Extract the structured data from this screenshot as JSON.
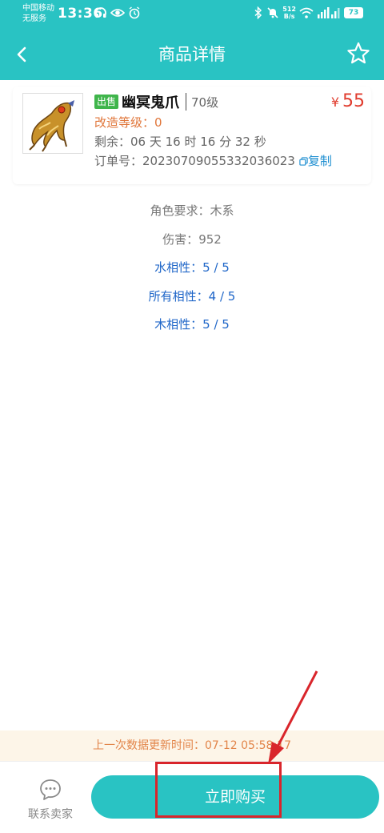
{
  "status_bar": {
    "carrier_line1": "中国移动",
    "carrier_line2": "无服务",
    "time": "13:36",
    "net_speed_value": "512",
    "net_speed_unit": "B/s",
    "battery": "73",
    "icons": [
      "headphones-icon",
      "eye-icon",
      "alarm-icon",
      "bluetooth-icon",
      "mute-icon",
      "wifi-icon",
      "signal-icon"
    ]
  },
  "header": {
    "title": "商品详情",
    "back_icon": "back-icon",
    "favorite_icon": "star-icon"
  },
  "product": {
    "badge": "出售",
    "name": "幽冥鬼爪",
    "level": "70级",
    "price_symbol": "¥",
    "price": "55",
    "refine_label": "改造等级：",
    "refine_value": "0",
    "remaining_label": "剩余：",
    "remaining_value": "06 天 16 时 16 分 32 秒",
    "order_label": "订单号：",
    "order_value": "20230709055332036023",
    "copy_label": "复制"
  },
  "attributes": [
    {
      "label": "角色要求：",
      "value": "木系",
      "color": "#777777"
    },
    {
      "label": "伤害：",
      "value": "952",
      "color": "#777777"
    },
    {
      "label": "水相性：",
      "value": "5 / 5",
      "color": "#1f66c8"
    },
    {
      "label": "所有相性：",
      "value": "4 / 5",
      "color": "#1f66c8"
    },
    {
      "label": "木相性：",
      "value": "5 / 5",
      "color": "#1f66c8"
    }
  ],
  "update_bar": {
    "text": "上一次数据更新时间：07-12 05:58:17"
  },
  "bottom": {
    "contact_label": "联系卖家",
    "buy_label": "立即购买"
  },
  "colors": {
    "accent": "#29c3c3",
    "price": "#e03c2e",
    "refine": "#e0763a",
    "link": "#1f8fd1",
    "annotation": "#d9252b"
  }
}
